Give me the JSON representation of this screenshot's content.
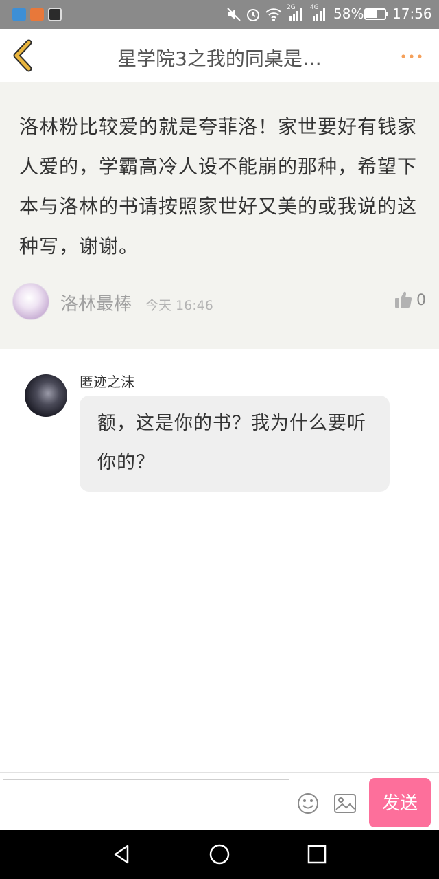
{
  "status_bar": {
    "network_labels": [
      "2G",
      "4G"
    ],
    "battery_percent": "58%",
    "battery_level": 0.58,
    "time": "17:56"
  },
  "header": {
    "title": "星学院3之我的同桌是…"
  },
  "post": {
    "text": "洛林粉比较爱的就是夸菲洛！家世要好有钱家人爱的，学霸高冷人设不能崩的那种，希望下本与洛林的书请按照家世好又美的或我说的这种写，谢谢。",
    "author": "洛林最棒",
    "time": "今天 16:46",
    "likes": "0"
  },
  "reply": {
    "author": "匿迹之沫",
    "text": "额，这是你的书？我为什么要听你的？"
  },
  "input_bar": {
    "placeholder": "",
    "send_label": "发送"
  },
  "colors": {
    "accent": "#fd6f9b",
    "back_arrow": "#e9b53e",
    "more_dots": "#f5a05a",
    "post_background": "#f3f3ef"
  }
}
